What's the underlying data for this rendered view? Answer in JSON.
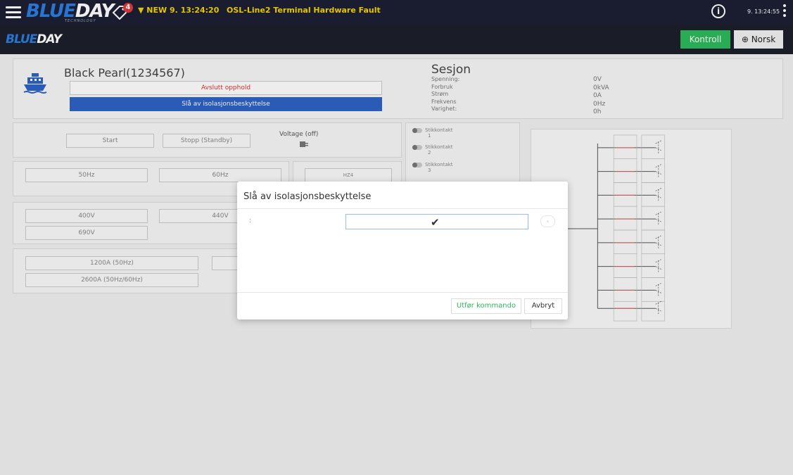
{
  "topbar": {
    "brand_blue": "BLUE",
    "brand_white": "DAY",
    "brand_sub": "TECHNOLOGY",
    "alarm_count": "4",
    "new_alarm": "▼ NEW 9. 13:24:20",
    "fault_text": "OSL-Line2 Terminal Hardware Fault",
    "info_icon": "i",
    "clock": "9. 13:24:55"
  },
  "subbar": {
    "brand_blue": "BLUE",
    "brand_white": "DAY",
    "kontroll_label": "Kontroll",
    "norsk_label": "⊕ Norsk"
  },
  "vessel": {
    "name": "Black Pearl(1234567)",
    "end_stay_label": "Avslutt opphold",
    "disable_isolation_label": "Slå av isolasjonsbeskyttelse"
  },
  "session": {
    "title": "Sesjon",
    "labels": [
      "Spenning:",
      "Forbruk",
      "Strøm",
      "Frekvens",
      "Varighet:"
    ],
    "values": [
      "0V",
      "0kVA",
      "0A",
      "0Hz",
      "0h"
    ]
  },
  "controls": {
    "start": "Start",
    "stop": "Stopp (Standby)",
    "voltage": "Voltage (off)",
    "hz50": "50Hz",
    "hz60": "60Hz",
    "hz_other": "HZ4",
    "v400": "400V",
    "v440": "440V",
    "v690": "690V",
    "a1200": "1200A (50Hz)",
    "a2600": "2600A (50Hz/60Hz)"
  },
  "sockets": [
    {
      "label": "Stikkontakt",
      "num": "1"
    },
    {
      "label": "Stikkontakt",
      "num": "2"
    },
    {
      "label": "Stikkontakt",
      "num": "3"
    }
  ],
  "modal": {
    "title": "Slå av isolasjonsbeskyttelse",
    "field_label": ":",
    "check_glyph": "✔",
    "undo_glyph": "‹",
    "execute_label": "Utfør kommando",
    "cancel_label": "Avbryt"
  },
  "colors": {
    "accent_green": "#2eb85c",
    "accent_blue": "#2e62c4",
    "alarm_yellow": "#f6d400",
    "alarm_red": "#e23a3a"
  }
}
